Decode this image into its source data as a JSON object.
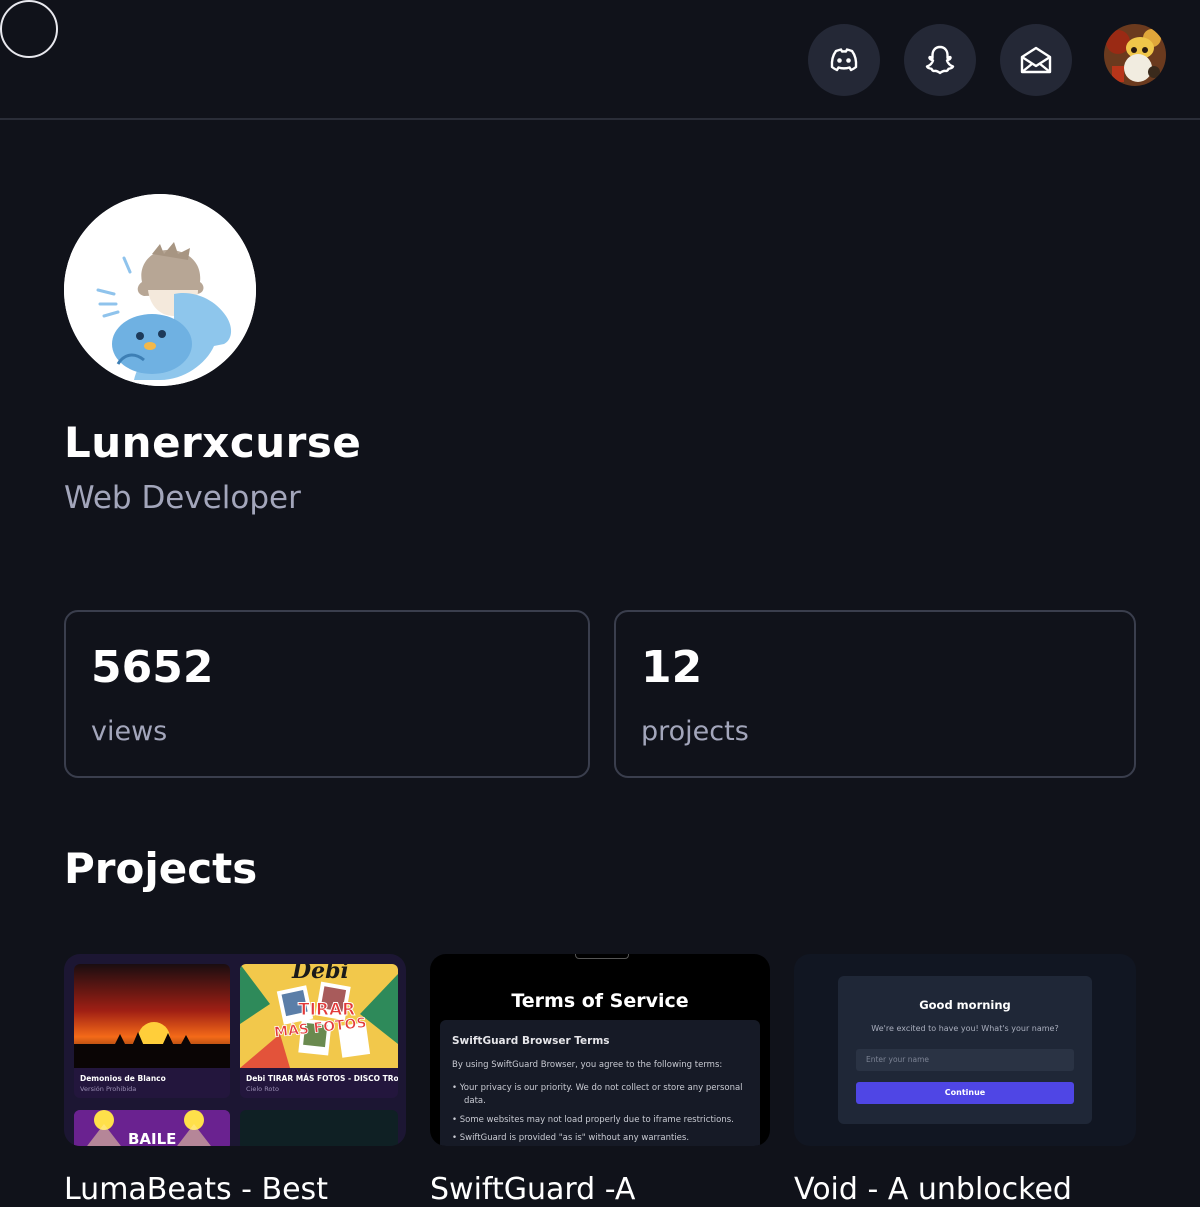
{
  "header": {
    "icons": [
      "discord-icon",
      "snapchat-icon",
      "mail-icon"
    ]
  },
  "profile": {
    "name": "Lunerxcurse",
    "role": "Web Developer"
  },
  "stats": [
    {
      "value": "5652",
      "label": "views"
    },
    {
      "value": "12",
      "label": "projects"
    }
  ],
  "projects_title": "Projects",
  "projects": [
    {
      "title": "LumaBeats - Best",
      "preview": {
        "tiles": [
          {
            "title": "Demonios de Blanco",
            "subtitle": "Versión Prohibida"
          },
          {
            "title": "Debi TIRAR MÁS FOTOS - DISCO TRo...",
            "subtitle": "Cielo Roto"
          }
        ],
        "art_text": {
          "debi": "Debi",
          "tirar": "TIRAR",
          "fotos": "MÁS FOTOS",
          "baile": "BAILE"
        }
      }
    },
    {
      "title": "SwiftGuard -A",
      "preview": {
        "heading": "Terms of Service",
        "subheading": "SwiftGuard Browser Terms",
        "intro": "By using SwiftGuard Browser, you agree to the following terms:",
        "bullets": [
          "Your privacy is our priority. We do not collect or store any personal",
          "data.",
          "Some websites may not load properly due to iframe restrictions.",
          "SwiftGuard is provided \"as is\" without any warranties."
        ]
      }
    },
    {
      "title": "Void - A unblocked",
      "preview": {
        "greeting": "Good morning",
        "prompt": "We're excited to have you! What's your name?",
        "placeholder": "Enter your name",
        "button": "Continue"
      }
    }
  ]
}
